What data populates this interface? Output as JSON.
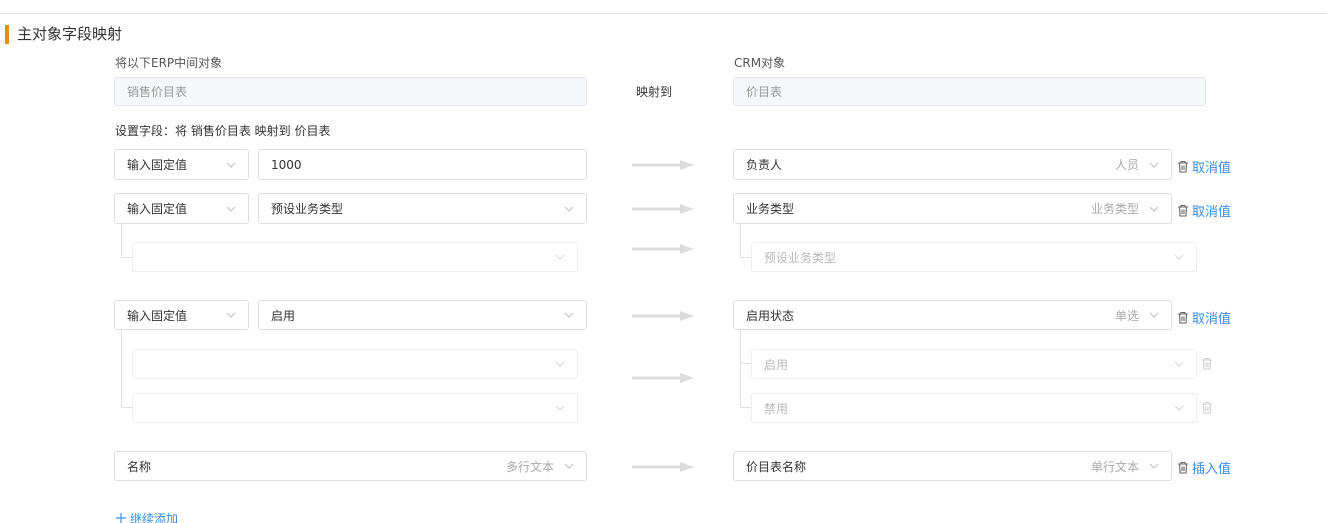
{
  "section": {
    "title": "主对象字段映射"
  },
  "header": {
    "left_label": "将以下ERP中间对象",
    "right_label": "CRM对象",
    "mid_label": "映射到",
    "left_value": "销售价目表",
    "right_value": "价目表"
  },
  "settings_label": "设置字段：将 销售价目表 映射到 价目表",
  "rows": [
    {
      "type": "输入固定值",
      "value": "1000",
      "target": "负责人",
      "target_hint": "人员",
      "action": "取消值"
    },
    {
      "type": "输入固定值",
      "value": "预设业务类型",
      "target": "业务类型",
      "target_hint": "业务类型",
      "action": "取消值",
      "sub_right": [
        "预设业务类型"
      ]
    },
    {
      "type": "输入固定值",
      "value": "启用",
      "target": "启用状态",
      "target_hint": "单选",
      "action": "取消值",
      "sub_right": [
        "启用",
        "禁用"
      ]
    },
    {
      "field": "名称",
      "field_hint": "多行文本",
      "target": "价目表名称",
      "target_hint": "单行文本",
      "action": "插入值"
    }
  ],
  "add_label": "继续添加",
  "colors": {
    "accent": "#f08c00",
    "link": "#3a8ee6"
  }
}
